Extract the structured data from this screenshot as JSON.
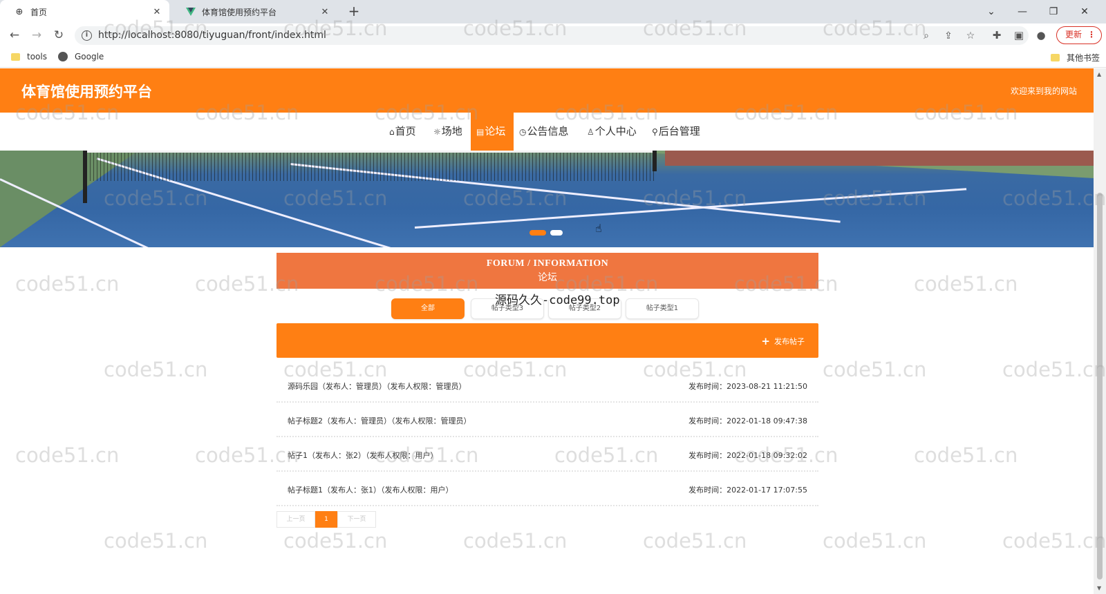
{
  "browser": {
    "tabs": [
      {
        "title": "首页",
        "active": true,
        "icon": "globe-icon"
      },
      {
        "title": "体育馆使用预约平台",
        "active": false,
        "icon": "vue-logo-icon"
      }
    ],
    "new_tab": "+",
    "url": "http://localhost:8080/tiyuguan/front/index.html",
    "update_label": "更新",
    "bookmarks": [
      {
        "label": "tools",
        "icon": "folder-icon"
      },
      {
        "label": "Google",
        "icon": "globe-icon"
      }
    ],
    "other_bookmarks": "其他书签"
  },
  "site": {
    "title": "体育馆使用预约平台",
    "welcome": "欢迎来到我的网站",
    "brand_color": "#ff7f13",
    "nav": [
      {
        "glyph": "⌂",
        "label": "首页",
        "active": false
      },
      {
        "glyph": "☼",
        "label": "场地",
        "active": false
      },
      {
        "glyph": "▤",
        "label": "论坛",
        "active": true
      },
      {
        "glyph": "◷",
        "label": "公告信息",
        "active": false
      },
      {
        "glyph": "♙",
        "label": "个人中心",
        "active": false
      },
      {
        "glyph": "⚲",
        "label": "后台管理",
        "active": false
      }
    ]
  },
  "section": {
    "title_en": "FORUM / INFORMATION",
    "title_cn": "论坛",
    "overlay": "源码久久-code99.top"
  },
  "types": [
    "全部",
    "帖子类型3",
    "帖子类型2",
    "帖子类型1"
  ],
  "publish_label": "发布帖子",
  "posts": [
    {
      "title": "源码乐园（发布人：管理员）（发布人权限：管理员）",
      "time": "发布时间：2023-08-21 11:21:50"
    },
    {
      "title": "帖子标题2（发布人：管理员）（发布人权限：管理员）",
      "time": "发布时间：2022-01-18 09:47:38"
    },
    {
      "title": "帖子1（发布人：张2）（发布人权限：用户）",
      "time": "发布时间：2022-01-18 09:32:02"
    },
    {
      "title": "帖子标题1（发布人：张1）（发布人权限：用户）",
      "time": "发布时间：2022-01-17 17:07:55"
    }
  ],
  "pagination": {
    "prev": "上一页",
    "current": "1",
    "next": "下一页"
  },
  "watermark": "code51.cn"
}
